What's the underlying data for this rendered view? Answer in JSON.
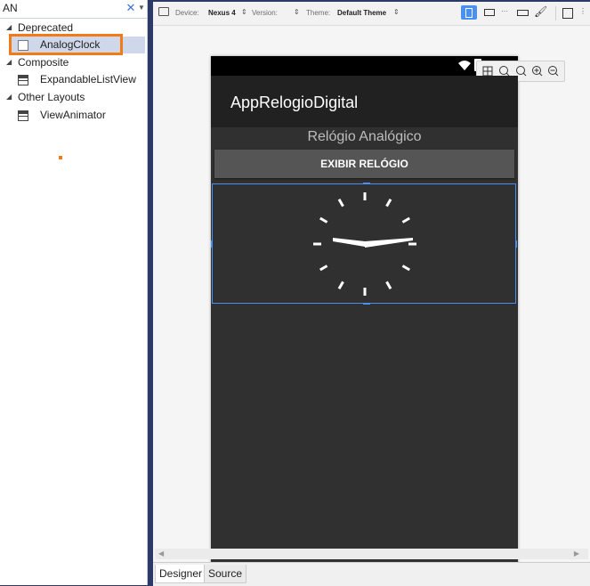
{
  "search": {
    "value": "AN",
    "clear_icon": "close-icon",
    "dropdown_icon": "chevron-down-icon"
  },
  "toolbox": {
    "categories": [
      {
        "label": "Deprecated",
        "items": [
          {
            "label": "AnalogClock",
            "icon": "checkbox-icon",
            "selected": true
          }
        ]
      },
      {
        "label": "Composite",
        "items": [
          {
            "label": "ExpandableListView",
            "icon": "widget-icon"
          }
        ]
      },
      {
        "label": "Other Layouts",
        "items": [
          {
            "label": "ViewAnimator",
            "icon": "widget-icon"
          }
        ]
      }
    ]
  },
  "toolbar": {
    "device_label": "Device:",
    "device_value": "Nexus 4",
    "version_label": "Version:",
    "theme_label": "Theme:",
    "theme_value": "Default Theme"
  },
  "phone": {
    "app_title": "AppRelogioDigital",
    "subtitle": "Relógio Analógico",
    "button_label": "EXIBIR RELÓGIO"
  },
  "tabs": {
    "designer": "Designer",
    "source": "Source"
  },
  "colors": {
    "accent": "#4a8ff2",
    "highlight": "#f07b17",
    "selection": "#cce0ff"
  }
}
